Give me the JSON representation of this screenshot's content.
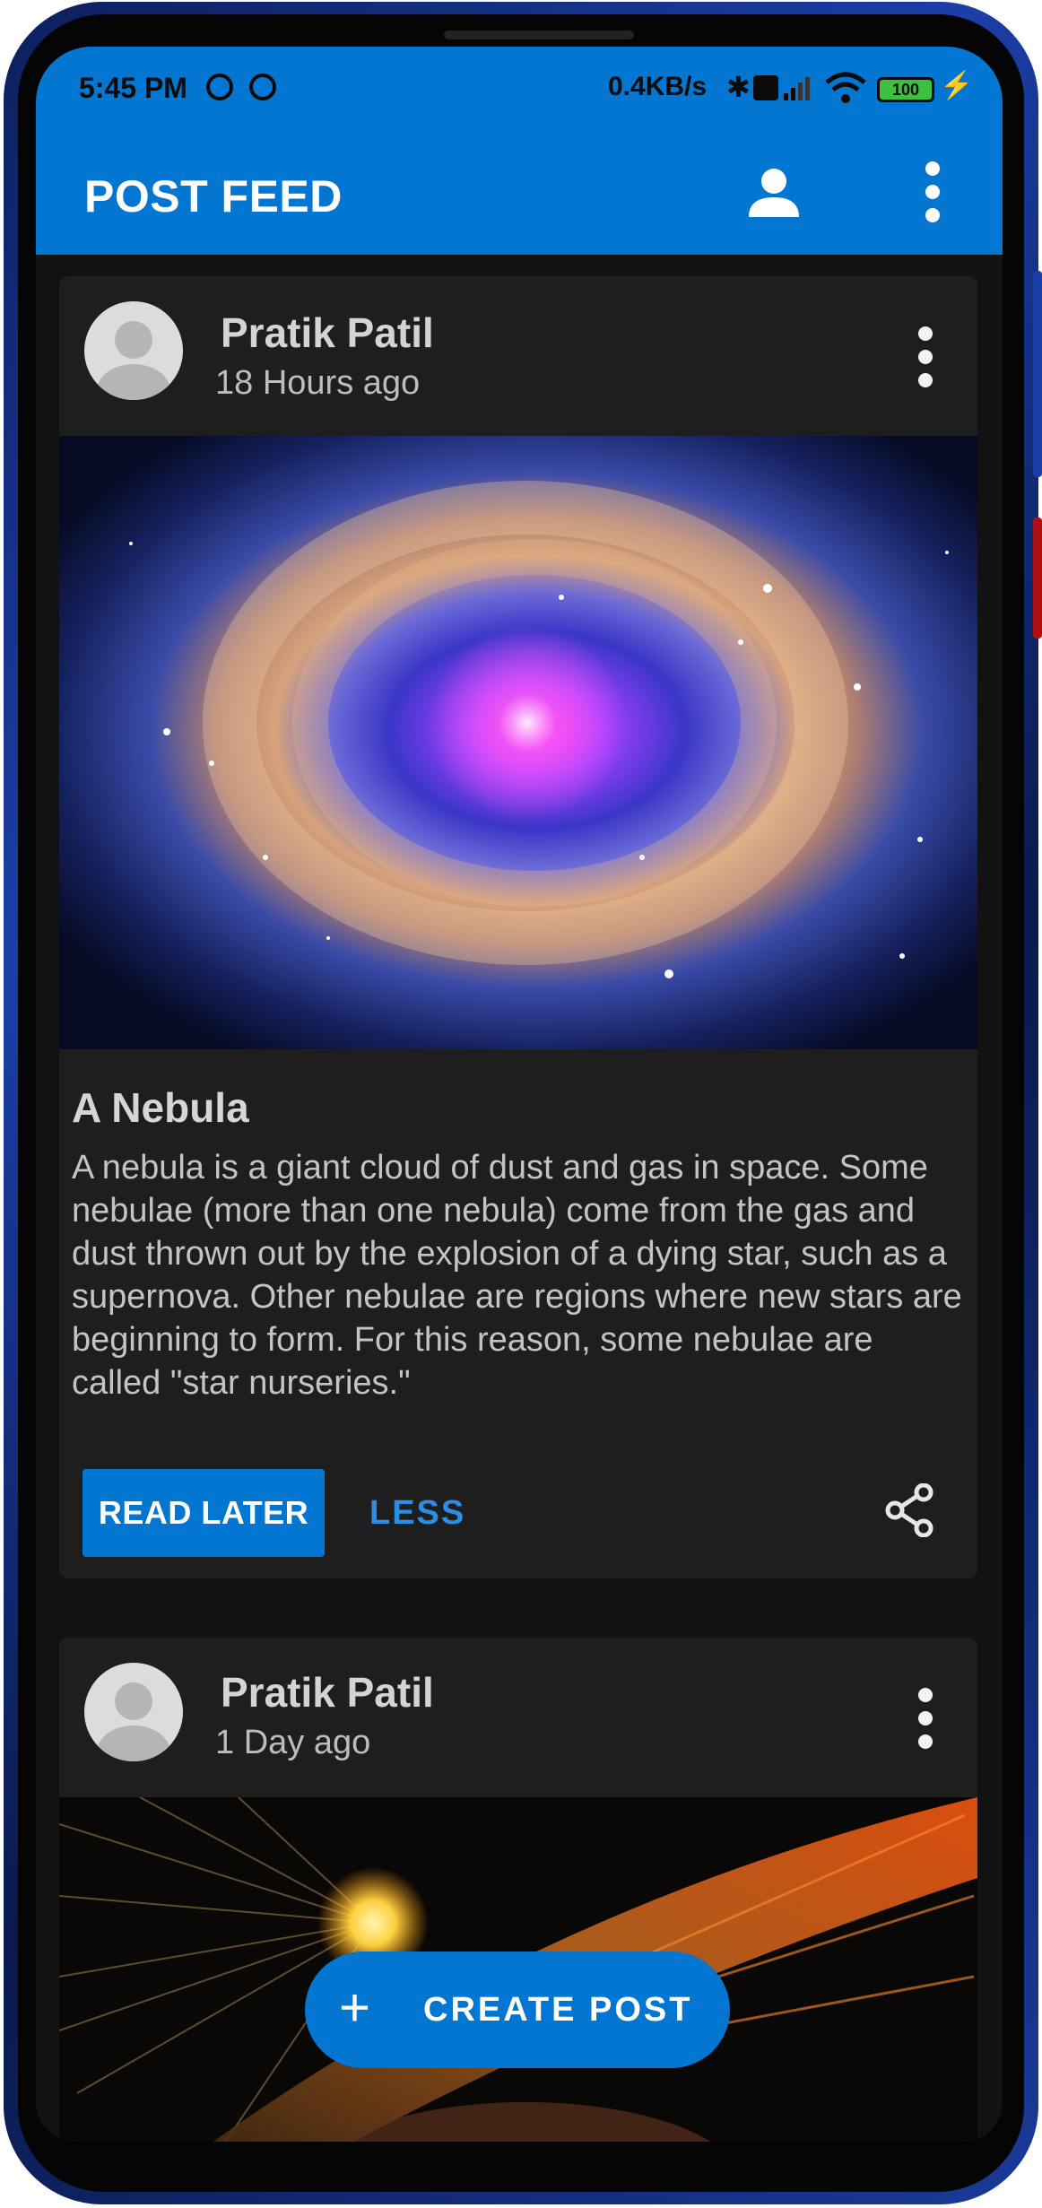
{
  "status_bar": {
    "time": "5:45 PM",
    "network_speed": "0.4KB/s",
    "battery": "100",
    "icons": [
      "sync-icon",
      "sync-icon",
      "bluetooth-icon",
      "volte-icon",
      "signal-icon",
      "wifi-icon",
      "battery-icon",
      "charging-icon"
    ]
  },
  "app_bar": {
    "title": "POST FEED",
    "icons": [
      "profile-icon",
      "more-vert-icon"
    ]
  },
  "posts": [
    {
      "author": "Pratik Patil",
      "time_ago": "18 Hours ago",
      "image": "nebula-image",
      "title": "A Nebula",
      "body": "A nebula is a giant cloud of dust and gas in space. Some nebulae (more than one nebula) come from the gas and dust thrown out by the explosion of a dying star, such as a supernova. Other nebulae are regions where new stars are beginning to form. For this reason, some nebulae are called \"star nurseries.\"",
      "actions": {
        "read_later": "READ LATER",
        "less": "LESS",
        "share_icon": "share-icon"
      }
    },
    {
      "author": "Pratik Patil",
      "time_ago": "1 Day ago",
      "image": "star-explosion-image"
    }
  ],
  "fab": {
    "icon": "+",
    "label": "CREATE POST"
  },
  "colors": {
    "primary": "#0276d0",
    "card": "#1e1e1e",
    "background": "#121212",
    "accent_text": "#2b8de6"
  }
}
